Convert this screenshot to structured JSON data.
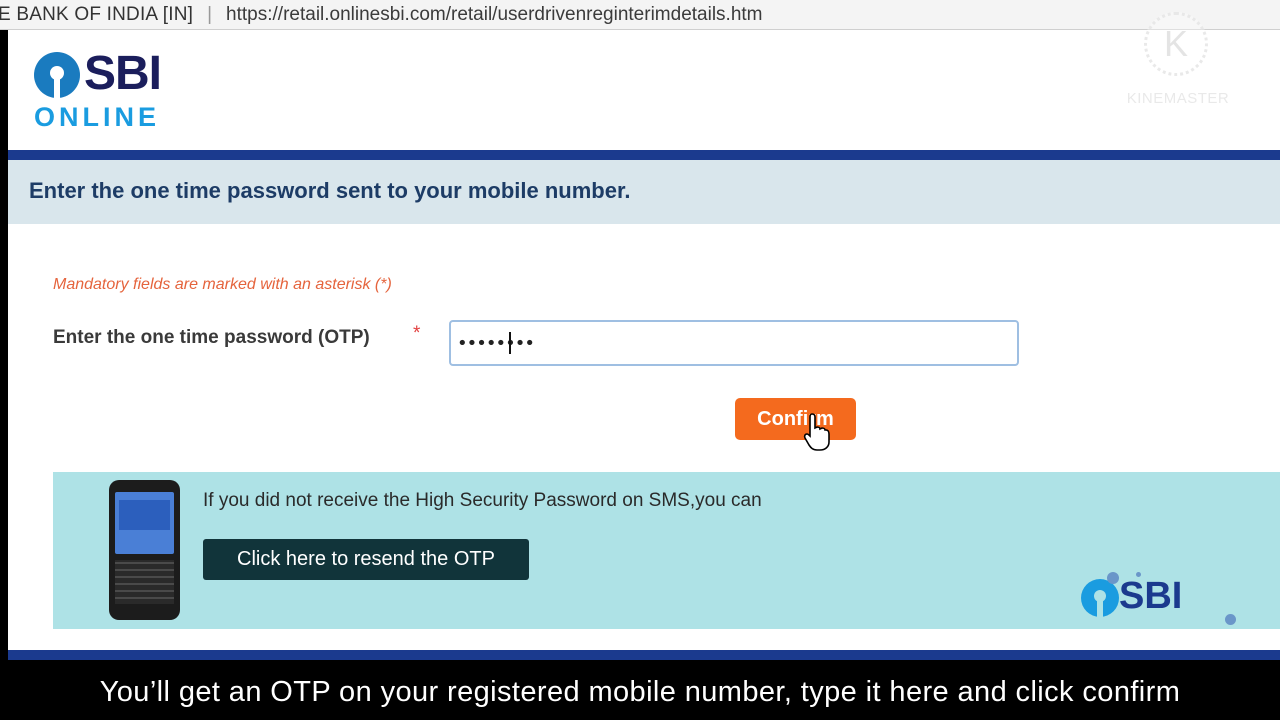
{
  "browser": {
    "site_label": "E BANK OF INDIA [IN]",
    "separator": "|",
    "url": "https://retail.onlinesbi.com/retail/userdrivenreginterimdetails.htm"
  },
  "logo": {
    "brand": "SBI",
    "sub": "ONLINE"
  },
  "watermark": {
    "glyph": "K",
    "text": "KINEMASTER"
  },
  "heading": "Enter the one time password sent to your mobile number.",
  "form": {
    "mandatory_note": "Mandatory fields are marked with an asterisk (*)",
    "otp_label": "Enter the one time password (OTP)",
    "asterisk": "*",
    "otp_value": "••••••••",
    "confirm_label": "Confirm"
  },
  "resend_panel": {
    "text": "If you did not receive the High Security Password on SMS,you can",
    "button_label": "Click here to resend the OTP",
    "brand": "SBI"
  },
  "caption": "You’ll get an OTP on your registered mobile number, type it here and click confirm",
  "colors": {
    "accent_orange": "#f46a1e",
    "navy": "#1b3a8e",
    "panel_teal": "#aee2e6",
    "heading_bg": "#d9e6ec"
  }
}
